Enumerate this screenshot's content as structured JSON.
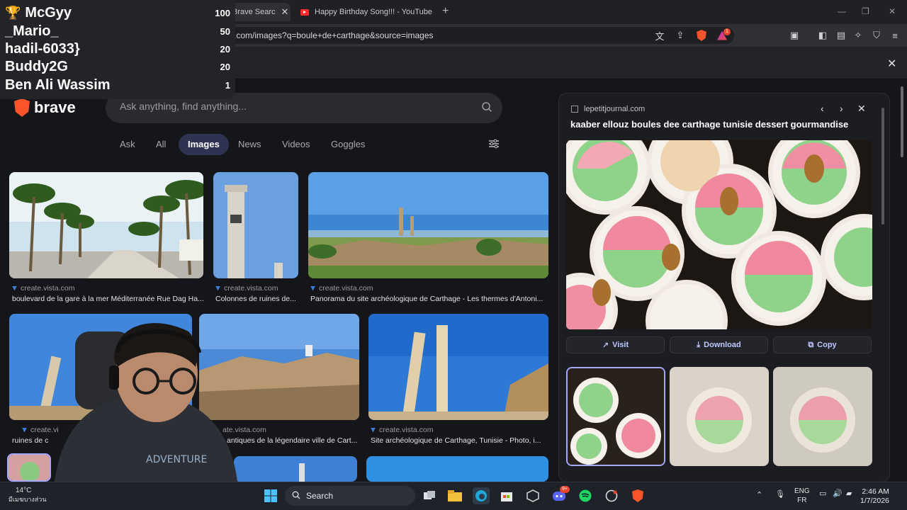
{
  "leaderboard": [
    {
      "name": "McGyy",
      "score": "100"
    },
    {
      "name": "_Mario_",
      "score": "50"
    },
    {
      "name": "hadil-6033}",
      "score": "20"
    },
    {
      "name": "Buddy2G",
      "score": "20"
    },
    {
      "name": "Ben Ali Wassim",
      "score": "1"
    }
  ],
  "browser": {
    "tabs": [
      {
        "title": "Brave Searc"
      },
      {
        "title": "Happy Birthday Song!!! - YouTube"
      }
    ],
    "url": ".com/images?q=boule+de+carthage&source=images",
    "rewards_badge": "1"
  },
  "search": {
    "brand": "brave",
    "placeholder": "Ask anything, find anything...",
    "tabs": [
      "Ask",
      "All",
      "Images",
      "News",
      "Videos",
      "Goggles"
    ],
    "selected_tab": "Images"
  },
  "results": [
    {
      "source": "create.vista.com",
      "caption": "boulevard de la gare à la mer Méditerranée Rue Dag Ha..."
    },
    {
      "source": "create.vista.com",
      "caption": "Colonnes de ruines de..."
    },
    {
      "source": "create.vista.com",
      "caption": "Panorama du site archéologique de Carthage - Les thermes d'Antoni..."
    },
    {
      "source": "create.vi",
      "caption": "ruines de c"
    },
    {
      "source": "ate.vista.com",
      "caption": "antiques de la légendaire ville de Cart..."
    },
    {
      "source": "create.vista.com",
      "caption": "Site archéologique de Carthage, Tunisie - Photo, i..."
    }
  ],
  "panel": {
    "domain": "lepetitjournal.com",
    "title": "kaaber ellouz boules dee carthage tunisie dessert gourmandise",
    "buttons": [
      "Visit",
      "Download",
      "Copy"
    ]
  },
  "taskbar": {
    "temperature": "14°C",
    "weather_text": "มีเมฆบางส่วน",
    "search_label": "Search",
    "discord_badge": "9+",
    "lang1": "ENG",
    "lang2": "FR",
    "time": "2:46 AM",
    "date": "1/7/2026"
  },
  "colors": {
    "accent": "#2f3352",
    "brave": "#fb542b",
    "selected_border": "#a6a8ff"
  }
}
